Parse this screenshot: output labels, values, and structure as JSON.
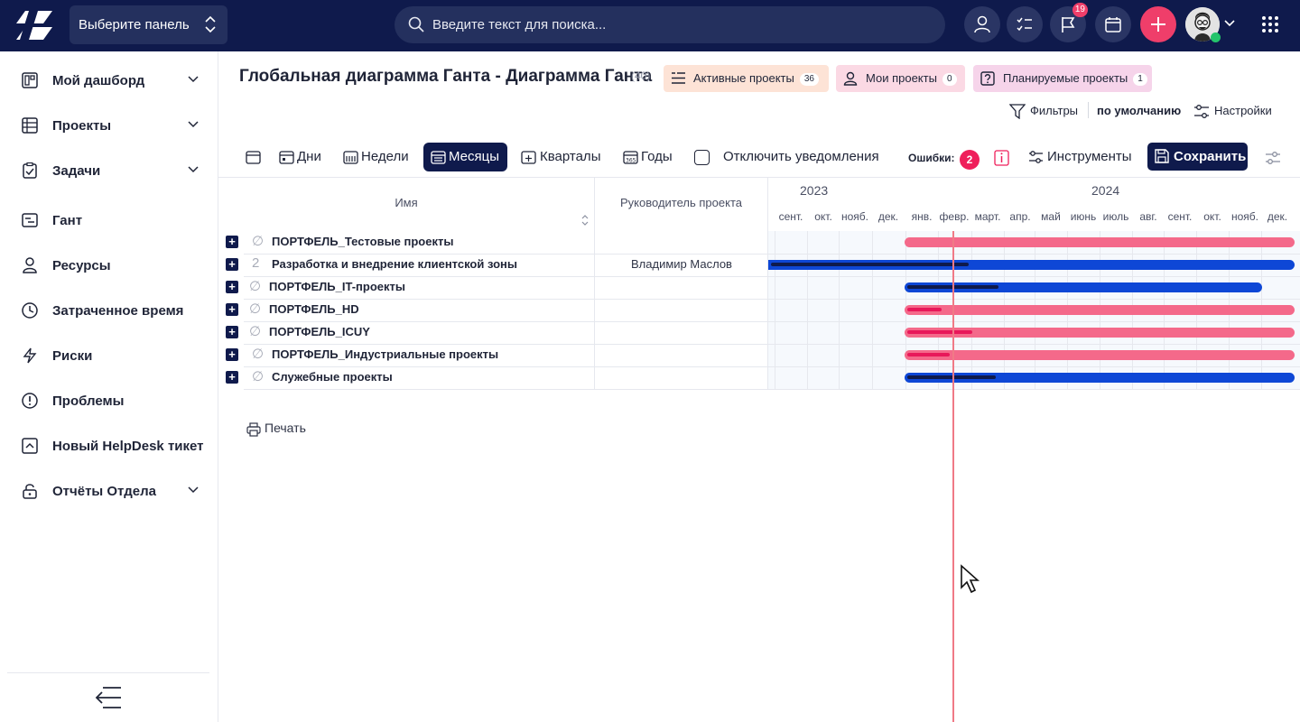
{
  "topbar": {
    "panel_select": "Выберите панель",
    "search_placeholder": "Введите текст для поиска...",
    "notifications_badge": "19"
  },
  "sidebar": {
    "items": [
      {
        "label": "Мой дашборд",
        "icon": "dashboard-icon",
        "expandable": true
      },
      {
        "label": "Проекты",
        "icon": "projects-icon",
        "expandable": true
      },
      {
        "label": "Задачи",
        "icon": "tasks-icon",
        "expandable": true
      },
      {
        "label": "Гант",
        "icon": "gantt-icon",
        "expandable": false
      },
      {
        "label": "Ресурсы",
        "icon": "user-icon",
        "expandable": false
      },
      {
        "label": "Затраченное время",
        "icon": "clock-icon",
        "expandable": false
      },
      {
        "label": "Риски",
        "icon": "lightning-icon",
        "expandable": false
      },
      {
        "label": "Проблемы",
        "icon": "alert-circle-icon",
        "expandable": false
      },
      {
        "label": "Новый HelpDesk тикет",
        "icon": "helpdesk-icon",
        "expandable": false
      },
      {
        "label": "Отчёты Отдела",
        "icon": "lock-icon",
        "expandable": true
      }
    ]
  },
  "header": {
    "title": "Глобальная диаграмма Ганта - Диаграмма Ганта",
    "count": "(40)",
    "chips": [
      {
        "label": "Активные проекты",
        "count": "36"
      },
      {
        "label": "Мои проекты",
        "count": "0"
      },
      {
        "label": "Планируемые проекты",
        "count": "1"
      }
    ],
    "filters_label": "Фильтры",
    "filters_default": "по умолчанию",
    "settings_label": "Настройки"
  },
  "toolbar": {
    "days": "Дни",
    "weeks": "Недели",
    "months": "Месяцы",
    "quarters": "Кварталы",
    "years": "Годы",
    "disable_notifications": "Отключить уведомления",
    "errors_label": "Ошибки:",
    "errors_count": "2",
    "tools": "Инструменты",
    "save": "Сохранить"
  },
  "gantt": {
    "columns": {
      "name": "Имя",
      "manager": "Руководитель проекта"
    },
    "years": [
      "2023",
      "2024"
    ],
    "months": [
      "сент.",
      "окт.",
      "нояб.",
      "дек.",
      "янв.",
      "февр.",
      "март.",
      "апр.",
      "май",
      "июнь",
      "июль",
      "авг.",
      "сент.",
      "окт.",
      "нояб.",
      "дек."
    ],
    "rows": [
      {
        "glyph": "∅",
        "name": "ПОРТФЕЛЬ_Тестовые проекты",
        "manager": "",
        "bar_color": "#f4698a",
        "progress": 0.0
      },
      {
        "glyph": "2",
        "name": "Разработка и внедрение клиентской зоны",
        "manager": "Владимир Маслов",
        "bar_color": "#0e47d6",
        "progress": 0.38
      },
      {
        "glyph": "∅",
        "name": "ПОРТФЕЛЬ_IT-проекты",
        "manager": "",
        "bar_color": "#0e47d6",
        "progress": 0.26
      },
      {
        "glyph": "∅",
        "name": "ПОРТФЕЛЬ_HD",
        "manager": "",
        "bar_color": "#f4698a",
        "progress": 0.09
      },
      {
        "glyph": "∅",
        "name": "ПОРТФЕЛЬ_ICUY",
        "manager": "",
        "bar_color": "#f4698a",
        "progress": 0.17
      },
      {
        "glyph": "∅",
        "name": "ПОРТФЕЛЬ_Индустриальные проекты",
        "manager": "",
        "bar_color": "#f4698a",
        "progress": 0.11
      },
      {
        "glyph": "∅",
        "name": "Служебные проекты",
        "manager": "",
        "bar_color": "#0e47d6",
        "progress": 0.23
      }
    ],
    "print_label": "Печать"
  },
  "colors": {
    "navy": "#0f1a4c",
    "accent_pink": "#ef3e6a",
    "bar_pink": "#f4698a",
    "bar_blue": "#0e47d6",
    "today_line": "#f07a86"
  }
}
